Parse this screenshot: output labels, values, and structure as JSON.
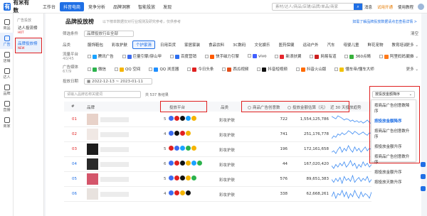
{
  "header": {
    "logo_mark": "有",
    "logo_text": "有米有数",
    "nav": [
      "工作台",
      "抖音电商",
      "竞争分析",
      "品牌洞察",
      "智能投放",
      "发现"
    ],
    "active_nav": 1,
    "search_placeholder": "素材/达人/商品/店铺/品牌/单品/商家",
    "right_links": [
      "消息",
      "试用开通",
      "使用教程"
    ]
  },
  "sidebar": {
    "items": [
      "商品",
      "广告",
      "店铺",
      "达人",
      "品牌",
      "直播",
      "商家"
    ],
    "active": 1
  },
  "subnav": {
    "header": "广告投放",
    "items": [
      {
        "label": "达人投流榜",
        "badge": "HOT"
      },
      {
        "label": "品牌投放榜",
        "badge": "NEW"
      }
    ],
    "active": 1
  },
  "main": {
    "title": "品牌投放榜",
    "desc": "以下榜单数据仅对行业观测及研究参考，仅供参考",
    "link": "如需了解品牌投放数据请点击查看详情 >",
    "filter_condition": {
      "label": "筛选条件",
      "value": "品牌投放行业全部",
      "clear": "清空"
    },
    "category": {
      "label": "品类",
      "items": [
        "服饰鞋包",
        "彩妆护肤",
        "个护家清",
        "日用百货",
        "家居家装",
        "食品饮料",
        "3C数码",
        "文化娱乐",
        "医药保健",
        "运动户外",
        "汽车",
        "母婴儿童",
        "鲜花宠物",
        "教育培训"
      ],
      "selected": 2,
      "more": "更多"
    },
    "platform": {
      "label": "流量平台",
      "count": "40/45",
      "items": [
        "腾讯广告",
        "巨量引擎/穿山甲",
        "百度营销",
        "快手磁力引擎",
        "vivo",
        "新浪扶翼",
        "网易有道",
        "360点睛",
        "阿里妈妈汇川"
      ],
      "colors": [
        "#1aa3ff",
        "#3c6cf0",
        "#2d6ff0",
        "#ff5a00",
        "#415fff",
        "#e6262d",
        "#cc1f1f",
        "#38b13c",
        "#ff7a1a"
      ],
      "more": "更多"
    },
    "media": {
      "label": "广告媒体",
      "count": "67/9",
      "items": [
        "微信",
        "QQ 空间",
        "QQ 浏览器",
        "今日头条",
        "西瓜视频",
        "抖音短视频",
        "抖音火山版",
        "懂车帝/懂车大师"
      ],
      "colors": [
        "#2bb24c",
        "#f5b400",
        "#1f8fff",
        "#e02020",
        "#e34e1a",
        "#111111",
        "#ff6b00",
        "#f2c200"
      ],
      "more": "更多"
    },
    "date": {
      "label": "投放日期",
      "value": "2022-12-13 ~ 2023-01-11"
    },
    "toolbar": {
      "search_placeholder": "请输入品牌名称关键词",
      "count_text": "共 537 条结果",
      "sort_selected": "按投放金额降序"
    },
    "table_headers": {
      "index": "#",
      "brand": "品牌",
      "platform": "投放平台",
      "category": "品类",
      "radio_count": "商品广告创意数",
      "radio_amount": "投放金额估算（元）",
      "trend": "近 30 天投放趋势"
    },
    "rows": [
      {
        "rank": "01",
        "plat_count": "5",
        "category": "彩妆护肤",
        "count": "722",
        "amount": "1,554,125,786",
        "plats": [
          "#3c6cf0",
          "#e02020",
          "#111111",
          "#1aa3ff",
          "#f5b400"
        ],
        "trend": [
          30,
          28,
          26,
          31,
          29,
          27,
          24,
          26,
          25,
          22,
          24,
          21,
          23,
          20,
          22,
          19,
          21,
          24,
          20,
          18
        ],
        "brand_color": "#e8d2c9"
      },
      {
        "rank": "02",
        "plat_count": "4",
        "category": "彩妆护肤",
        "count": "741",
        "amount": "251,176,778",
        "plats": [
          "#3c6cf0",
          "#111111",
          "#e02020",
          "#f5b400"
        ],
        "trend": [
          18,
          22,
          20,
          25,
          23,
          27,
          24,
          26,
          30,
          28,
          25,
          29,
          27,
          24,
          26,
          28,
          25,
          23,
          27,
          26
        ],
        "brand_color": "#f0e8e4"
      },
      {
        "rank": "03",
        "plat_count": "5",
        "category": "彩妆护肤",
        "count": "196",
        "amount": "172,161,658",
        "plats": [
          "#e02020",
          "#3c6cf0",
          "#1aa3ff",
          "#2bb24c",
          "#f5b400"
        ],
        "trend": [
          20,
          21,
          19,
          22,
          24,
          20,
          23,
          21,
          25,
          22,
          20,
          24,
          21,
          23,
          20,
          22,
          24,
          21,
          23,
          22
        ],
        "brand_color": "#1c1c1c"
      },
      {
        "rank": "04",
        "plat_count": "6",
        "category": "彩妆护肤",
        "count": "44",
        "amount": "167,020,420",
        "plats": [
          "#3c6cf0",
          "#e02020",
          "#111111",
          "#f5b400",
          "#1aa3ff",
          "#2bb24c"
        ],
        "trend": [
          22,
          20,
          23,
          21,
          24,
          22,
          25,
          21,
          23,
          26,
          22,
          24,
          20,
          23,
          21,
          25,
          22,
          24,
          21,
          23
        ],
        "brand_color": "#2a2a2a"
      },
      {
        "rank": "05",
        "plat_count": "5",
        "category": "彩妆护肤",
        "count": "576",
        "amount": "89,651,383",
        "plats": [
          "#3c6cf0",
          "#e02020",
          "#111111",
          "#f5b400",
          "#2bb24c"
        ],
        "trend": [
          24,
          21,
          25,
          22,
          26,
          20,
          27,
          23,
          25,
          22,
          28,
          21,
          24,
          26,
          22,
          25,
          23,
          27,
          21,
          24
        ],
        "brand_color": "#d4556a"
      },
      {
        "rank": "06",
        "plat_count": "4",
        "category": "彩妆护肤",
        "count": "338",
        "amount": "62,668,261",
        "plats": [
          "#3c6cf0",
          "#e02020",
          "#f5b400",
          "#111111"
        ],
        "trend": [
          22,
          25,
          21,
          24,
          23,
          26,
          22,
          25,
          21,
          24,
          22,
          26,
          23,
          21,
          25,
          22,
          24,
          23,
          21,
          25
        ],
        "brand_color": "#e8e2de"
      }
    ],
    "sort_options": [
      "按商品广告创意数降序",
      "按投放金额降序",
      "按商品广告创意数升序",
      "按投放金额升序",
      "按商品广告创意数升序",
      "按投放金额升序",
      "按投放天数升序"
    ],
    "sort_active": 1
  }
}
